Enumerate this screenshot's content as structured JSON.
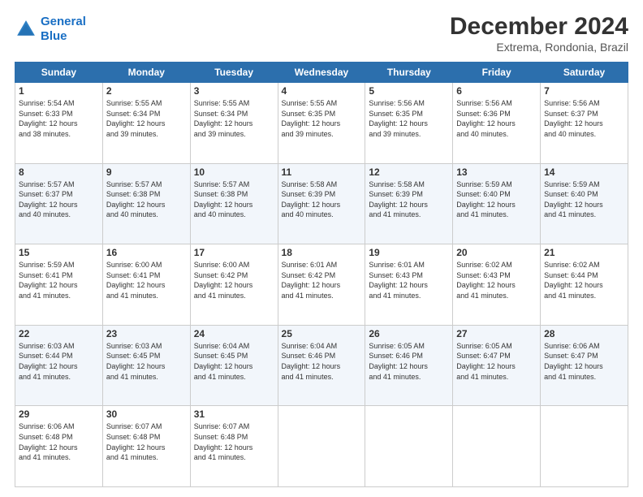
{
  "header": {
    "logo_line1": "General",
    "logo_line2": "Blue",
    "month": "December 2024",
    "location": "Extrema, Rondonia, Brazil"
  },
  "weekdays": [
    "Sunday",
    "Monday",
    "Tuesday",
    "Wednesday",
    "Thursday",
    "Friday",
    "Saturday"
  ],
  "weeks": [
    [
      {
        "day": "1",
        "info": "Sunrise: 5:54 AM\nSunset: 6:33 PM\nDaylight: 12 hours\nand 38 minutes."
      },
      {
        "day": "2",
        "info": "Sunrise: 5:55 AM\nSunset: 6:34 PM\nDaylight: 12 hours\nand 39 minutes."
      },
      {
        "day": "3",
        "info": "Sunrise: 5:55 AM\nSunset: 6:34 PM\nDaylight: 12 hours\nand 39 minutes."
      },
      {
        "day": "4",
        "info": "Sunrise: 5:55 AM\nSunset: 6:35 PM\nDaylight: 12 hours\nand 39 minutes."
      },
      {
        "day": "5",
        "info": "Sunrise: 5:56 AM\nSunset: 6:35 PM\nDaylight: 12 hours\nand 39 minutes."
      },
      {
        "day": "6",
        "info": "Sunrise: 5:56 AM\nSunset: 6:36 PM\nDaylight: 12 hours\nand 40 minutes."
      },
      {
        "day": "7",
        "info": "Sunrise: 5:56 AM\nSunset: 6:37 PM\nDaylight: 12 hours\nand 40 minutes."
      }
    ],
    [
      {
        "day": "8",
        "info": "Sunrise: 5:57 AM\nSunset: 6:37 PM\nDaylight: 12 hours\nand 40 minutes."
      },
      {
        "day": "9",
        "info": "Sunrise: 5:57 AM\nSunset: 6:38 PM\nDaylight: 12 hours\nand 40 minutes."
      },
      {
        "day": "10",
        "info": "Sunrise: 5:57 AM\nSunset: 6:38 PM\nDaylight: 12 hours\nand 40 minutes."
      },
      {
        "day": "11",
        "info": "Sunrise: 5:58 AM\nSunset: 6:39 PM\nDaylight: 12 hours\nand 40 minutes."
      },
      {
        "day": "12",
        "info": "Sunrise: 5:58 AM\nSunset: 6:39 PM\nDaylight: 12 hours\nand 41 minutes."
      },
      {
        "day": "13",
        "info": "Sunrise: 5:59 AM\nSunset: 6:40 PM\nDaylight: 12 hours\nand 41 minutes."
      },
      {
        "day": "14",
        "info": "Sunrise: 5:59 AM\nSunset: 6:40 PM\nDaylight: 12 hours\nand 41 minutes."
      }
    ],
    [
      {
        "day": "15",
        "info": "Sunrise: 5:59 AM\nSunset: 6:41 PM\nDaylight: 12 hours\nand 41 minutes."
      },
      {
        "day": "16",
        "info": "Sunrise: 6:00 AM\nSunset: 6:41 PM\nDaylight: 12 hours\nand 41 minutes."
      },
      {
        "day": "17",
        "info": "Sunrise: 6:00 AM\nSunset: 6:42 PM\nDaylight: 12 hours\nand 41 minutes."
      },
      {
        "day": "18",
        "info": "Sunrise: 6:01 AM\nSunset: 6:42 PM\nDaylight: 12 hours\nand 41 minutes."
      },
      {
        "day": "19",
        "info": "Sunrise: 6:01 AM\nSunset: 6:43 PM\nDaylight: 12 hours\nand 41 minutes."
      },
      {
        "day": "20",
        "info": "Sunrise: 6:02 AM\nSunset: 6:43 PM\nDaylight: 12 hours\nand 41 minutes."
      },
      {
        "day": "21",
        "info": "Sunrise: 6:02 AM\nSunset: 6:44 PM\nDaylight: 12 hours\nand 41 minutes."
      }
    ],
    [
      {
        "day": "22",
        "info": "Sunrise: 6:03 AM\nSunset: 6:44 PM\nDaylight: 12 hours\nand 41 minutes."
      },
      {
        "day": "23",
        "info": "Sunrise: 6:03 AM\nSunset: 6:45 PM\nDaylight: 12 hours\nand 41 minutes."
      },
      {
        "day": "24",
        "info": "Sunrise: 6:04 AM\nSunset: 6:45 PM\nDaylight: 12 hours\nand 41 minutes."
      },
      {
        "day": "25",
        "info": "Sunrise: 6:04 AM\nSunset: 6:46 PM\nDaylight: 12 hours\nand 41 minutes."
      },
      {
        "day": "26",
        "info": "Sunrise: 6:05 AM\nSunset: 6:46 PM\nDaylight: 12 hours\nand 41 minutes."
      },
      {
        "day": "27",
        "info": "Sunrise: 6:05 AM\nSunset: 6:47 PM\nDaylight: 12 hours\nand 41 minutes."
      },
      {
        "day": "28",
        "info": "Sunrise: 6:06 AM\nSunset: 6:47 PM\nDaylight: 12 hours\nand 41 minutes."
      }
    ],
    [
      {
        "day": "29",
        "info": "Sunrise: 6:06 AM\nSunset: 6:48 PM\nDaylight: 12 hours\nand 41 minutes."
      },
      {
        "day": "30",
        "info": "Sunrise: 6:07 AM\nSunset: 6:48 PM\nDaylight: 12 hours\nand 41 minutes."
      },
      {
        "day": "31",
        "info": "Sunrise: 6:07 AM\nSunset: 6:48 PM\nDaylight: 12 hours\nand 41 minutes."
      },
      null,
      null,
      null,
      null
    ]
  ]
}
